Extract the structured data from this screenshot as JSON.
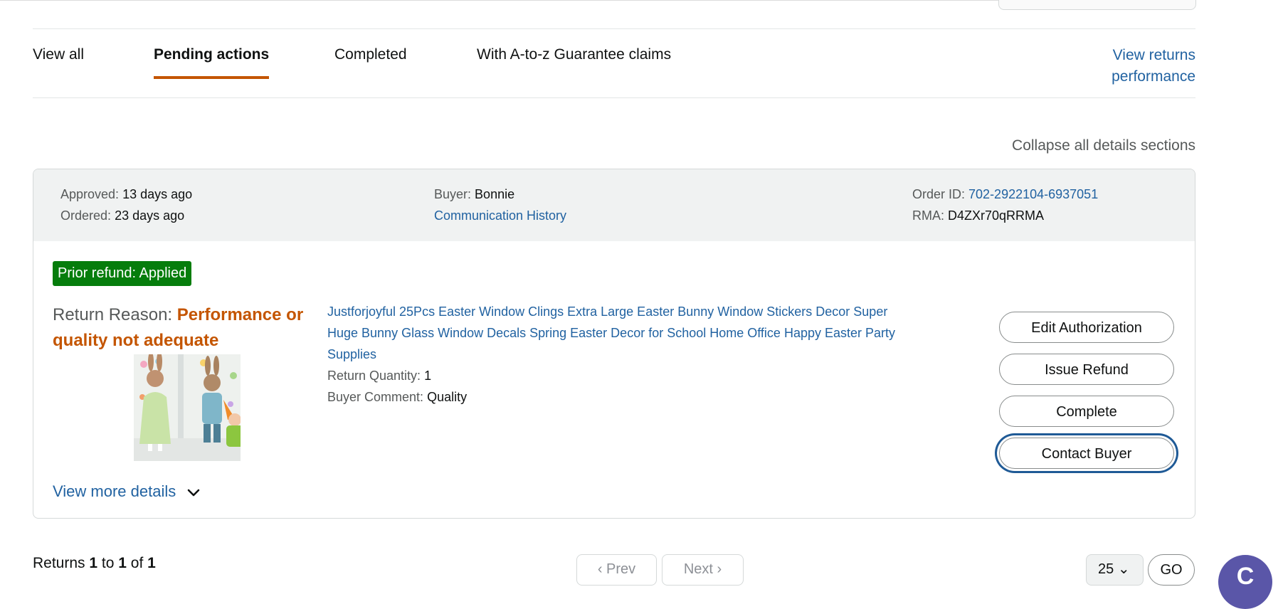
{
  "tabs": {
    "view_all": "View all",
    "pending": "Pending actions",
    "completed": "Completed",
    "atoz": "With A-to-z Guarantee claims"
  },
  "returns_performance": {
    "line1": "View returns",
    "line2": "performance"
  },
  "collapse_all": "Collapse all details sections",
  "return_card": {
    "approved_label": "Approved:",
    "approved_value": "13 days ago",
    "ordered_label": "Ordered:",
    "ordered_value": "23 days ago",
    "buyer_label": "Buyer:",
    "buyer_value": "Bonnie",
    "communication_history": "Communication History",
    "order_id_label": "Order ID:",
    "order_id_value": "702-2922104-6937051",
    "rma_label": "RMA:",
    "rma_value": "D4ZXr70qRRMA",
    "badge": "Prior refund: Applied",
    "reason_label": "Return Reason:",
    "reason_value": "Performance or quality not adequate",
    "product_title": "Justforjoyful 25Pcs Easter Window Clings Extra Large Easter Bunny Window Stickers Decor Super Huge Bunny Glass Window Decals Spring Easter Decor for School Home Office Happy Easter Party Supplies",
    "quantity_label": "Return Quantity:",
    "quantity_value": "1",
    "comment_label": "Buyer Comment:",
    "comment_value": "Quality",
    "buttons": {
      "edit": "Edit Authorization",
      "issue": "Issue Refund",
      "complete": "Complete",
      "contact": "Contact Buyer"
    },
    "view_more": "View more details"
  },
  "pagination": {
    "returns_prefix": "Returns",
    "from": "1",
    "to_word": "to",
    "to": "1",
    "of_word": "of",
    "total": "1",
    "prev": "Prev",
    "next": "Next",
    "per_page": "25",
    "go": "GO"
  },
  "icons": {
    "chevron": "chevron-down-icon",
    "help": "chat-help-icon"
  }
}
